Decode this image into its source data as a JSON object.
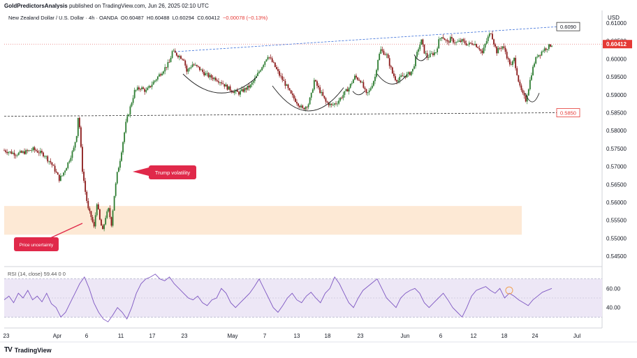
{
  "header": {
    "publisher": "GoldPredictorsAnalysis",
    "published_text": "published on TradingView.com, Jun 26, 2025 02:10 UTC"
  },
  "currency_label": "USD",
  "legend": {
    "symbol": "New Zealand Dollar / U.S. Dollar · 4h · OANDA",
    "o_label": "O",
    "o_value": "0.60487",
    "h_label": "H",
    "h_value": "0.60488",
    "l_label": "L",
    "l_value": "0.60294",
    "c_label": "C",
    "c_value": "0.60412",
    "change": "−0.00078 (−0.13%)"
  },
  "rsi_legend": "RSI (14, close)  59.44  0  0",
  "footer": {
    "brand": "TradingView"
  },
  "colors": {
    "up": "#2e7d32",
    "down": "#8b1a1a",
    "rsi_line": "#7e57c2",
    "rsi_band": "#ede7f6",
    "zone": "#fde9d5",
    "trend_blue": "#3b6fd9",
    "trend_dark": "#333333",
    "callout": "#e0294a",
    "price_tag": "#e53935"
  },
  "chart_data": {
    "type": "candlestick",
    "y_axis": {
      "min": 0.5425,
      "max": 0.6135,
      "ticks": [
        "0.61000",
        "0.60500",
        "0.60000",
        "0.59500",
        "0.59000",
        "0.58500",
        "0.58000",
        "0.57500",
        "0.57000",
        "0.56500",
        "0.56000",
        "0.55500",
        "0.55000",
        "0.54500"
      ]
    },
    "x_ticks": [
      "23",
      "Apr",
      "6",
      "11",
      "17",
      "23",
      "May",
      "7",
      "13",
      "18",
      "23",
      "Jun",
      "6",
      "12",
      "18",
      "24",
      "Jul"
    ],
    "last_price_label": "0.60412",
    "resistance_label": "0.6090",
    "support_label": "0.5850",
    "demand_zone": [
      0.551,
      0.559
    ],
    "annotations": [
      "Trump volatility",
      "Price uncertainty"
    ],
    "path_points": [
      [
        0,
        0.5745
      ],
      [
        4,
        0.574
      ],
      [
        8,
        0.5735
      ],
      [
        12,
        0.5738
      ],
      [
        16,
        0.5742
      ],
      [
        20,
        0.5748
      ],
      [
        24,
        0.574
      ],
      [
        28,
        0.5732
      ],
      [
        30,
        0.572
      ],
      [
        32,
        0.5712
      ],
      [
        35,
        0.569
      ],
      [
        38,
        0.5665
      ],
      [
        40,
        0.5675
      ],
      [
        43,
        0.57
      ],
      [
        46,
        0.573
      ],
      [
        48,
        0.575
      ],
      [
        50,
        0.579
      ],
      [
        51,
        0.5838
      ],
      [
        52,
        0.581
      ],
      [
        53,
        0.575
      ],
      [
        54,
        0.569
      ],
      [
        56,
        0.563
      ],
      [
        58,
        0.558
      ],
      [
        60,
        0.556
      ],
      [
        62,
        0.553
      ],
      [
        64,
        0.56
      ],
      [
        66,
        0.555
      ],
      [
        68,
        0.552
      ],
      [
        70,
        0.556
      ],
      [
        72,
        0.558
      ],
      [
        74,
        0.554
      ],
      [
        76,
        0.562
      ],
      [
        78,
        0.568
      ],
      [
        80,
        0.572
      ],
      [
        82,
        0.577
      ],
      [
        84,
        0.582
      ],
      [
        86,
        0.585
      ],
      [
        88,
        0.588
      ],
      [
        90,
        0.591
      ],
      [
        94,
        0.592
      ],
      [
        98,
        0.591
      ],
      [
        102,
        0.593
      ],
      [
        106,
        0.595
      ],
      [
        110,
        0.597
      ],
      [
        114,
        0.599
      ],
      [
        116,
        0.602
      ],
      [
        120,
        0.601
      ],
      [
        124,
        0.6
      ],
      [
        126,
        0.5965
      ],
      [
        130,
        0.5985
      ],
      [
        134,
        0.5975
      ],
      [
        138,
        0.596
      ],
      [
        142,
        0.595
      ],
      [
        146,
        0.5945
      ],
      [
        150,
        0.5935
      ],
      [
        154,
        0.592
      ],
      [
        158,
        0.591
      ],
      [
        162,
        0.5905
      ],
      [
        166,
        0.5915
      ],
      [
        170,
        0.5925
      ],
      [
        174,
        0.595
      ],
      [
        178,
        0.598
      ],
      [
        182,
        0.601
      ],
      [
        186,
        0.5985
      ],
      [
        190,
        0.5955
      ],
      [
        194,
        0.593
      ],
      [
        198,
        0.59
      ],
      [
        202,
        0.588
      ],
      [
        206,
        0.586
      ],
      [
        210,
        0.5875
      ],
      [
        212,
        0.59
      ],
      [
        214,
        0.594
      ],
      [
        218,
        0.591
      ],
      [
        222,
        0.588
      ],
      [
        226,
        0.587
      ],
      [
        230,
        0.588
      ],
      [
        234,
        0.59
      ],
      [
        238,
        0.592
      ],
      [
        242,
        0.595
      ],
      [
        246,
        0.594
      ],
      [
        248,
        0.592
      ],
      [
        250,
        0.59
      ],
      [
        252,
        0.591
      ],
      [
        256,
        0.595
      ],
      [
        258,
        0.6
      ],
      [
        260,
        0.6025
      ],
      [
        264,
        0.601
      ],
      [
        266,
        0.5985
      ],
      [
        268,
        0.596
      ],
      [
        270,
        0.5945
      ],
      [
        272,
        0.594
      ],
      [
        274,
        0.595
      ],
      [
        278,
        0.5955
      ],
      [
        280,
        0.596
      ],
      [
        282,
        0.597
      ],
      [
        284,
        0.6
      ],
      [
        286,
        0.603
      ],
      [
        288,
        0.605
      ],
      [
        290,
        0.602
      ],
      [
        292,
        0.6005
      ],
      [
        294,
        0.601
      ],
      [
        298,
        0.602
      ],
      [
        300,
        0.605
      ],
      [
        302,
        0.6065
      ],
      [
        306,
        0.6045
      ],
      [
        308,
        0.6055
      ],
      [
        312,
        0.6045
      ],
      [
        316,
        0.605
      ],
      [
        320,
        0.604
      ],
      [
        324,
        0.6045
      ],
      [
        328,
        0.603
      ],
      [
        330,
        0.6015
      ],
      [
        332,
        0.604
      ],
      [
        334,
        0.606
      ],
      [
        336,
        0.6075
      ],
      [
        338,
        0.6045
      ],
      [
        340,
        0.602
      ],
      [
        342,
        0.603
      ],
      [
        344,
        0.6035
      ],
      [
        346,
        0.602
      ],
      [
        348,
        0.5995
      ],
      [
        350,
        0.598
      ],
      [
        352,
        0.6
      ],
      [
        354,
        0.596
      ],
      [
        356,
        0.592
      ],
      [
        358,
        0.59
      ],
      [
        360,
        0.5885
      ],
      [
        362,
        0.592
      ],
      [
        364,
        0.596
      ],
      [
        366,
        0.599
      ],
      [
        368,
        0.601
      ],
      [
        370,
        0.6015
      ],
      [
        372,
        0.6025
      ],
      [
        374,
        0.603
      ],
      [
        376,
        0.6035
      ],
      [
        378,
        0.6041
      ]
    ],
    "rsi": {
      "levels": [
        70,
        30
      ],
      "tick_labels": [
        "60.00",
        "40.00"
      ],
      "y_range": [
        20,
        80
      ],
      "last_value": 59.44,
      "values": [
        48,
        52,
        45,
        55,
        50,
        58,
        48,
        52,
        46,
        55,
        44,
        40,
        30,
        35,
        45,
        55,
        65,
        72,
        60,
        45,
        35,
        28,
        25,
        32,
        40,
        35,
        28,
        40,
        55,
        65,
        70,
        72,
        75,
        70,
        68,
        72,
        65,
        60,
        55,
        50,
        48,
        52,
        45,
        42,
        48,
        50,
        60,
        55,
        45,
        40,
        45,
        50,
        55,
        62,
        70,
        60,
        50,
        40,
        35,
        42,
        50,
        55,
        48,
        45,
        52,
        56,
        50,
        45,
        55,
        60,
        72,
        65,
        55,
        45,
        40,
        50,
        58,
        62,
        66,
        70,
        60,
        50,
        45,
        40,
        50,
        55,
        58,
        60,
        55,
        45,
        40,
        45,
        50,
        55,
        48,
        40,
        35,
        30,
        40,
        52,
        58,
        60,
        62,
        58,
        55,
        60,
        50,
        55,
        52,
        48,
        45,
        42,
        48,
        52,
        56,
        58,
        60
      ]
    }
  }
}
